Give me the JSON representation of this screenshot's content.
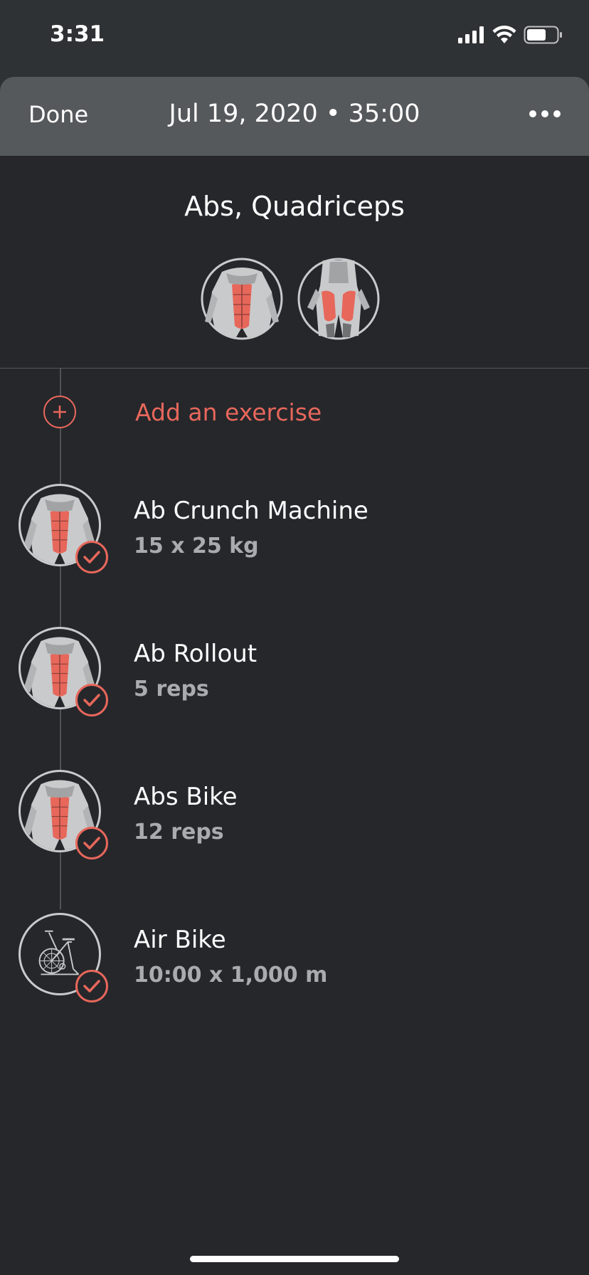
{
  "status": {
    "time": "3:31"
  },
  "nav": {
    "done_label": "Done",
    "title": "Jul 19, 2020 • 35:00"
  },
  "header": {
    "muscles_title": "Abs, Quadriceps"
  },
  "add_exercise": {
    "label": "Add an exercise"
  },
  "exercises": [
    {
      "name": "Ab Crunch Machine",
      "detail": "15 x 25 kg",
      "icon": "abs-muscle-icon"
    },
    {
      "name": "Ab Rollout",
      "detail": "5 reps",
      "icon": "abs-muscle-icon"
    },
    {
      "name": "Abs Bike",
      "detail": "12 reps",
      "icon": "abs-muscle-icon"
    },
    {
      "name": "Air Bike",
      "detail": "10:00 x 1,000 m",
      "icon": "air-bike-icon"
    }
  ],
  "colors": {
    "accent": "#e7675b",
    "background": "#25272b",
    "nav_background": "#55595c"
  }
}
